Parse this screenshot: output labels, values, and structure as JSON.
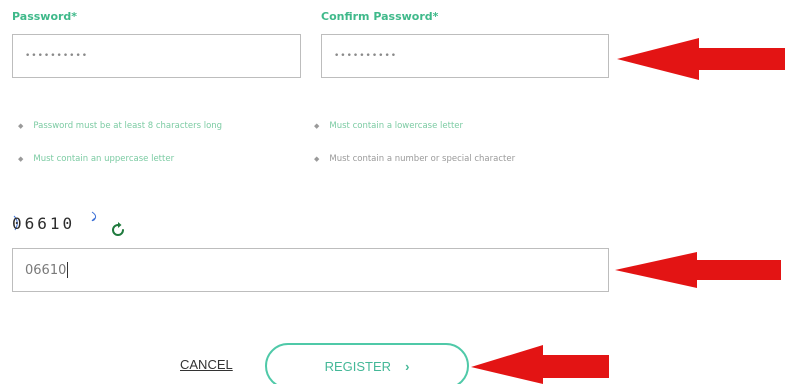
{
  "password": {
    "label": "Password*",
    "value": "••••••••••"
  },
  "confirm_password": {
    "label": "Confirm Password*",
    "value": "••••••••••"
  },
  "requirements": [
    {
      "text": "Password must be at least 8 characters long",
      "met": true
    },
    {
      "text": "Must contain a lowercase letter",
      "met": true
    },
    {
      "text": "Must contain an uppercase letter",
      "met": true
    },
    {
      "text": "Must contain a number or special character",
      "met": false
    }
  ],
  "captcha": {
    "text": "06610",
    "input_value": "06610",
    "refresh_icon": "refresh-icon"
  },
  "actions": {
    "cancel_label": "CANCEL",
    "register_label": "REGISTER",
    "register_chevron": "›"
  },
  "colors": {
    "accent": "#3fb98a",
    "register_border": "#4fc9a8",
    "annotation_arrow": "#e31414"
  }
}
